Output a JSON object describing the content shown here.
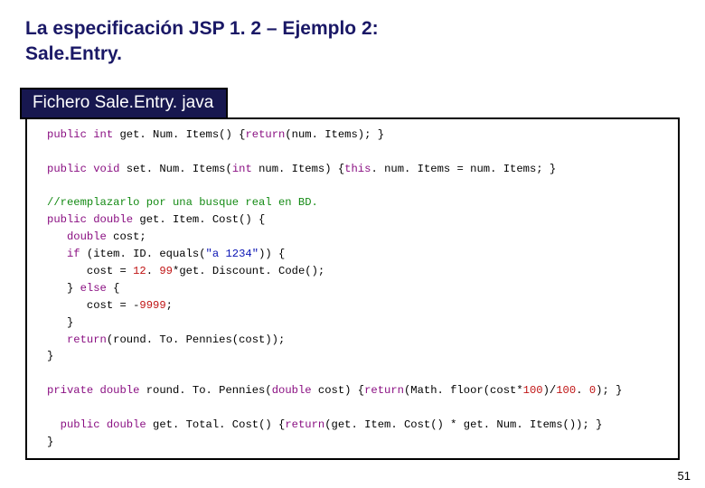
{
  "title_line1": "La especificación JSP 1. 2 – Ejemplo 2:",
  "title_line2": "Sale.Entry.",
  "file_label": "Fichero Sale.Entry. java",
  "page_number": "51",
  "code": {
    "l01a": " int",
    "l01b": " get. Num. Items() {",
    "l01c": "(num. Items); }",
    "l03a": " void",
    "l03b": " set. Num. Items(",
    "l03c": " num. Items) {",
    "l03d": ". num. Items = num. Items; }",
    "l05": "//reemplazarlo por una busque real en BD.",
    "l06a": " double",
    "l06b": " get. Item. Cost() {",
    "l07a": "   double",
    "l07b": " cost;",
    "l08a": "   if",
    "l08b": " (item. ID. equals(",
    "l08s": "\"a 1234\"",
    "l08c": ")) {",
    "l09a": "      cost = ",
    "l09n1": "12",
    "l09m": ". ",
    "l09n2": "99",
    "l09b": "*get. Discount. Code();",
    "l10a": "   } ",
    "l10b": " {",
    "l11a": "      cost = -",
    "l11n": "9999",
    "l11b": ";",
    "l12": "   }",
    "l13a": "   return",
    "l13b": "(round. To. Pennies(cost));",
    "l14": "}",
    "l16a": " double",
    "l16b": " round. To. Pennies(",
    "l16c": " cost) {",
    "l16d": "(Math. floor(cost*",
    "l16n1": "100",
    "l16e": ")/",
    "l16n2": "100",
    "l16f": ". ",
    "l16n3": "0",
    "l16g": "); }",
    "l18a": " double",
    "l18b": " get. Total. Cost() {",
    "l18c": "(get. Item. Cost() * get. Num. Items()); }",
    "kw_public": "public",
    "kw_private": "private",
    "kw_return": "return",
    "kw_this": "this",
    "kw_else": "else",
    "kw_int": "int",
    "kw_void": "void",
    "kw_double": "double",
    "kw_if": "if",
    "close_brace": "}"
  }
}
